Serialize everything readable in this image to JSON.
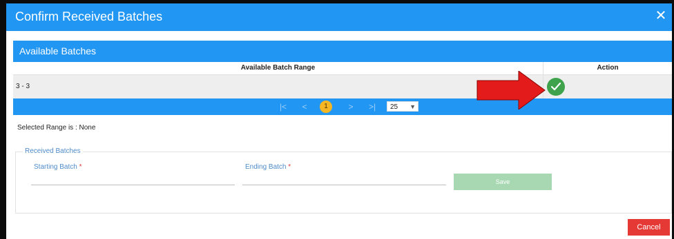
{
  "dialog": {
    "title": "Confirm Received Batches",
    "close_glyph": "✕"
  },
  "available": {
    "title": "Available Batches",
    "columns": [
      "Available Batch Range",
      "Action"
    ],
    "rows": [
      {
        "range": "3 - 3"
      }
    ],
    "pager": {
      "first": "|<",
      "prev": "<",
      "current": "1",
      "next": ">",
      "last": ">|",
      "page_size": "25"
    }
  },
  "selection": {
    "text": "Selected Range is : None"
  },
  "received": {
    "legend": "Received Batches",
    "starting_label": "Starting Batch",
    "ending_label": "Ending Batch",
    "required_mark": "*",
    "starting_value": "",
    "ending_value": "",
    "save_label": "Save"
  },
  "footer": {
    "cancel_label": "Cancel"
  },
  "colors": {
    "primary": "#2196f3",
    "success": "#3fa34d",
    "danger": "#e53935",
    "page_badge": "#f5b624",
    "annotation_arrow": "#e31b1b"
  }
}
